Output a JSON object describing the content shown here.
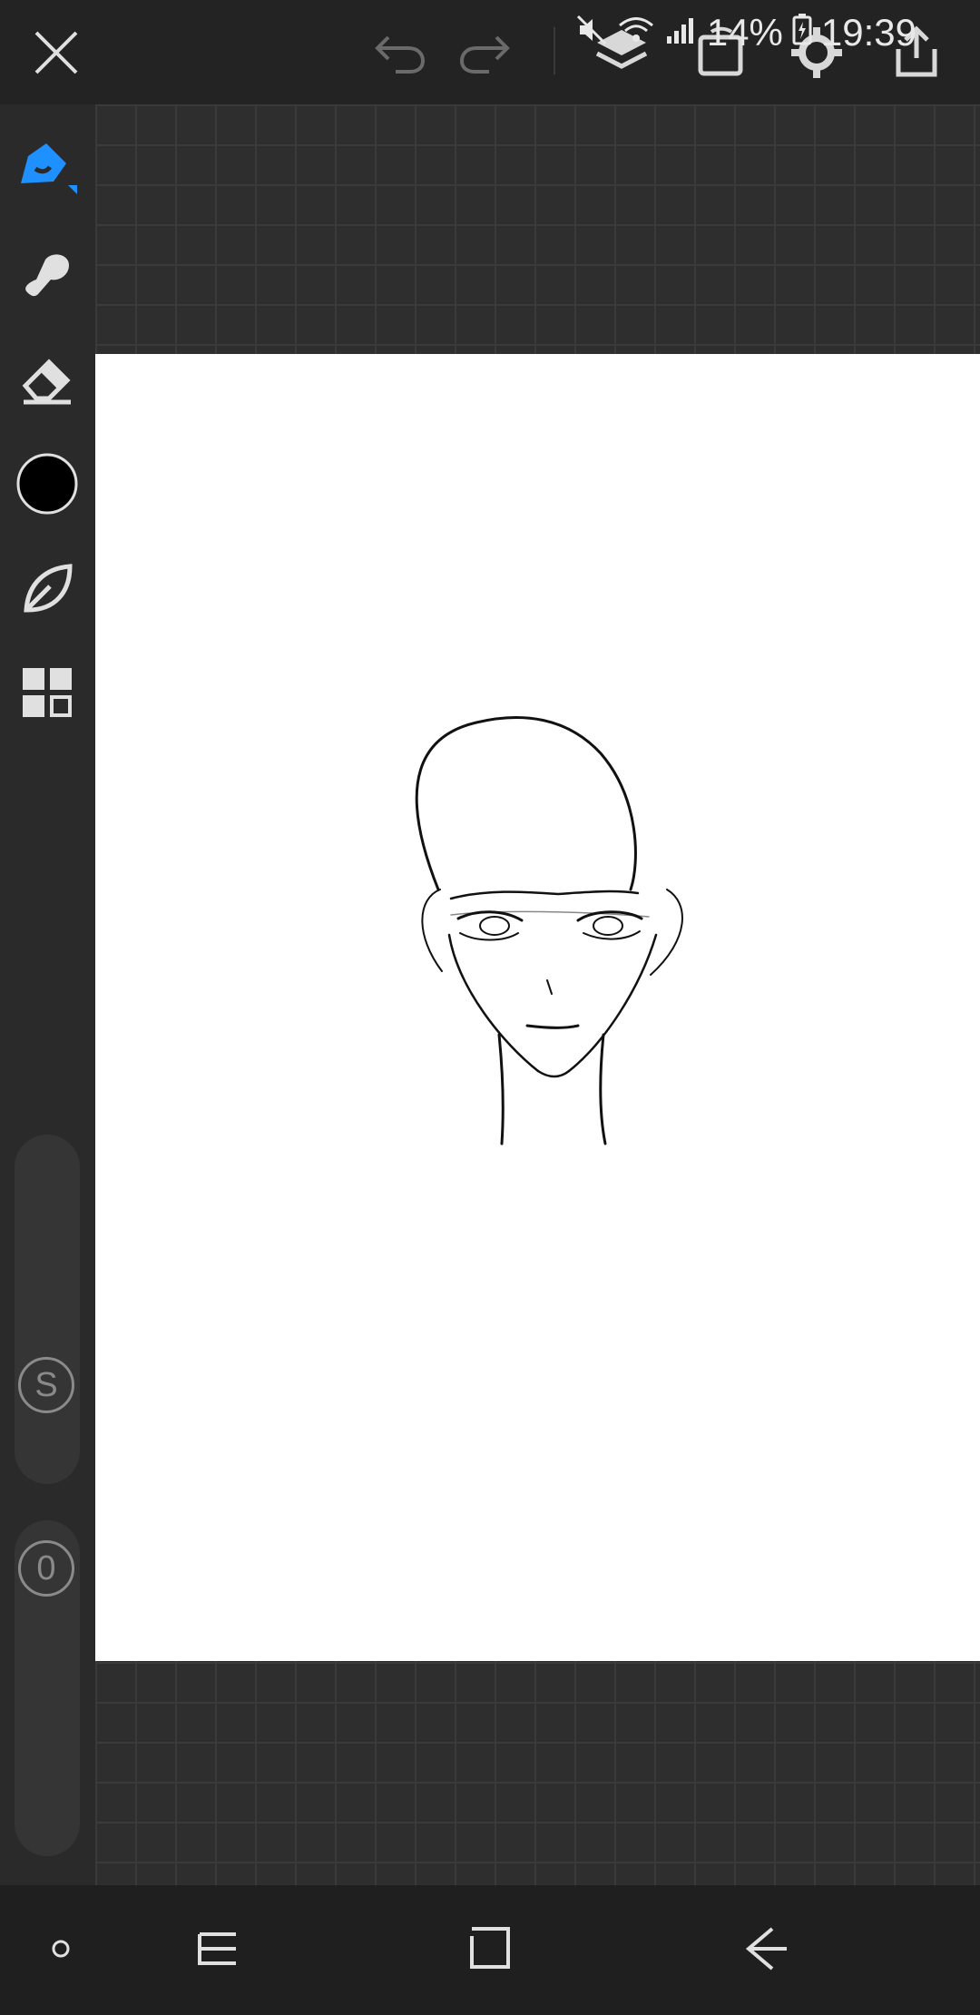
{
  "status": {
    "battery": "14%",
    "time": "19:39"
  },
  "toolbar": {
    "icons": [
      "close-icon",
      "undo-icon",
      "redo-icon",
      "layers-icon",
      "crop-rotate-icon",
      "settings-icon",
      "share-icon"
    ]
  },
  "sidebar": {
    "tools": [
      "pen-icon",
      "smudge-icon",
      "eraser-icon",
      "color-swatch",
      "leaf-icon",
      "grid-menu-icon"
    ],
    "active_tool": "pen-icon",
    "current_color": "#000000",
    "size_label": "S",
    "opacity_label": "0"
  },
  "nav": {
    "icons": [
      "dot-icon",
      "recent-apps-icon",
      "home-icon",
      "back-icon"
    ]
  },
  "colors": {
    "accent": "#1e90ff",
    "toolbar_bg": "#232323",
    "canvas_bg": "#ffffff"
  }
}
